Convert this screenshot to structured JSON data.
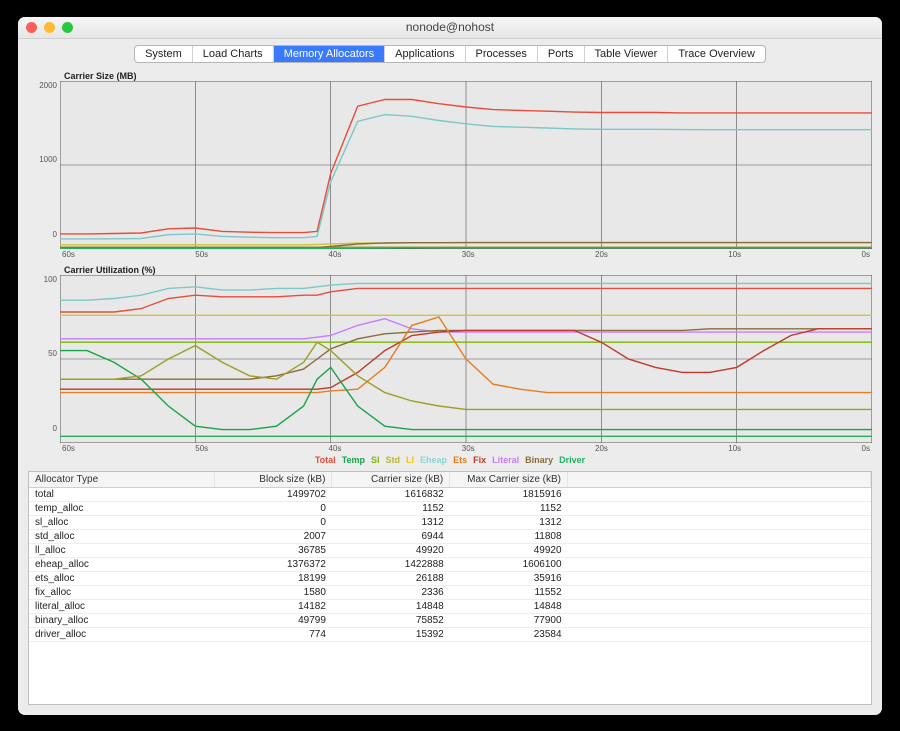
{
  "window_title": "nonode@nohost",
  "tabs": [
    "System",
    "Load Charts",
    "Memory Allocators",
    "Applications",
    "Processes",
    "Ports",
    "Table Viewer",
    "Trace Overview"
  ],
  "active_tab_index": 2,
  "legend": [
    {
      "name": "Total",
      "color": "#e74c3c"
    },
    {
      "name": "Temp",
      "color": "#1aa34a"
    },
    {
      "name": "Sl",
      "color": "#7ab800"
    },
    {
      "name": "Std",
      "color": "#b9b93a"
    },
    {
      "name": "Ll",
      "color": "#f1c40f"
    },
    {
      "name": "Eheap",
      "color": "#8fd3d3"
    },
    {
      "name": "Ets",
      "color": "#e67e22"
    },
    {
      "name": "Fix",
      "color": "#c0392b"
    },
    {
      "name": "Literal",
      "color": "#c77dff"
    },
    {
      "name": "Binary",
      "color": "#8a6d3b"
    },
    {
      "name": "Driver",
      "color": "#27ae60"
    }
  ],
  "chart_data": [
    {
      "type": "line",
      "title": "Carrier Size (MB)",
      "xlabel": "",
      "ylabel": "",
      "ylim": [
        0,
        2000
      ],
      "yticks": [
        0,
        1000,
        2000
      ],
      "xticks": [
        "60s",
        "50s",
        "40s",
        "30s",
        "20s",
        "10s",
        "0s"
      ],
      "x": [
        60,
        58,
        56,
        54,
        52,
        50,
        48,
        46,
        44,
        42,
        41,
        40,
        38,
        36,
        34,
        32,
        30,
        28,
        26,
        24,
        22,
        20,
        18,
        16,
        14,
        12,
        10,
        8,
        6,
        4,
        2,
        0
      ],
      "series": [
        {
          "name": "Total",
          "color": "#e74c3c",
          "values": [
            180,
            180,
            185,
            190,
            240,
            250,
            210,
            200,
            195,
            195,
            210,
            900,
            1700,
            1780,
            1780,
            1730,
            1690,
            1660,
            1650,
            1640,
            1630,
            1625,
            1625,
            1625,
            1620,
            1620,
            1620,
            1620,
            1620,
            1620,
            1620,
            1620
          ]
        },
        {
          "name": "Eheap",
          "color": "#7cc7c7",
          "values": [
            120,
            120,
            122,
            125,
            170,
            180,
            150,
            140,
            135,
            135,
            150,
            800,
            1520,
            1600,
            1580,
            1530,
            1490,
            1460,
            1450,
            1440,
            1430,
            1425,
            1425,
            1425,
            1422,
            1420,
            1420,
            1420,
            1420,
            1420,
            1420,
            1420
          ]
        },
        {
          "name": "Ll",
          "color": "#d0c438",
          "values": [
            50,
            50,
            50,
            50,
            50,
            50,
            50,
            50,
            50,
            50,
            55,
            60,
            70,
            72,
            74,
            75,
            76,
            76,
            76,
            76,
            76,
            76,
            76,
            76,
            76,
            76,
            76,
            76,
            76,
            76,
            76,
            76
          ]
        },
        {
          "name": "Std",
          "color": "#9e9e2a",
          "values": [
            22,
            22,
            22,
            22,
            22,
            22,
            22,
            22,
            22,
            22,
            22,
            22,
            22,
            22,
            22,
            22,
            22,
            22,
            22,
            22,
            22,
            22,
            22,
            22,
            22,
            22,
            22,
            22,
            22,
            22,
            22,
            22
          ]
        },
        {
          "name": "Binary",
          "color": "#8a6d3b",
          "values": [
            18,
            18,
            18,
            18,
            18,
            18,
            18,
            18,
            18,
            18,
            18,
            30,
            60,
            72,
            75,
            75,
            76,
            76,
            76,
            76,
            76,
            76,
            76,
            76,
            76,
            76,
            76,
            76,
            76,
            76,
            76,
            76
          ]
        },
        {
          "name": "Driver",
          "color": "#27ae60",
          "values": [
            8,
            8,
            8,
            8,
            8,
            8,
            8,
            8,
            8,
            8,
            8,
            8,
            10,
            12,
            14,
            15,
            15,
            15,
            15,
            15,
            15,
            15,
            15,
            15,
            15,
            15,
            15,
            15,
            15,
            15,
            15,
            15
          ]
        }
      ]
    },
    {
      "type": "line",
      "title": "Carrier Utilization (%)",
      "xlabel": "",
      "ylabel": "",
      "ylim": [
        0,
        100
      ],
      "yticks": [
        0,
        50,
        100
      ],
      "xticks": [
        "60s",
        "50s",
        "40s",
        "30s",
        "20s",
        "10s",
        "0s"
      ],
      "x": [
        60,
        58,
        56,
        54,
        52,
        50,
        48,
        46,
        44,
        42,
        41,
        40,
        38,
        36,
        34,
        32,
        30,
        28,
        26,
        24,
        22,
        20,
        18,
        16,
        14,
        12,
        10,
        8,
        6,
        4,
        2,
        0
      ],
      "series": [
        {
          "name": "Eheap",
          "color": "#7cc7c7",
          "values": [
            85,
            85,
            86,
            88,
            92,
            93,
            91,
            91,
            92,
            92,
            93,
            94,
            95,
            95,
            95,
            95,
            95,
            95,
            95,
            95,
            95,
            95,
            95,
            95,
            95,
            95,
            95,
            95,
            95,
            95,
            95,
            95
          ]
        },
        {
          "name": "Total",
          "color": "#e74c3c",
          "values": [
            78,
            78,
            78,
            80,
            86,
            88,
            87,
            87,
            87,
            88,
            88,
            90,
            92,
            92,
            92,
            92,
            92,
            92,
            92,
            92,
            92,
            92,
            92,
            92,
            92,
            92,
            92,
            92,
            92,
            92,
            92,
            92
          ]
        },
        {
          "name": "Ll",
          "color": "#d0c438",
          "values": [
            76,
            76,
            76,
            76,
            76,
            76,
            76,
            76,
            76,
            76,
            76,
            76,
            76,
            76,
            76,
            76,
            76,
            76,
            76,
            76,
            76,
            76,
            76,
            76,
            76,
            76,
            76,
            76,
            76,
            76,
            76,
            76
          ]
        },
        {
          "name": "Literal",
          "color": "#c77dff",
          "values": [
            62,
            62,
            62,
            62,
            62,
            62,
            62,
            62,
            62,
            62,
            63,
            64,
            70,
            74,
            68,
            66,
            66,
            66,
            66,
            66,
            66,
            66,
            66,
            66,
            66,
            66,
            66,
            66,
            66,
            66,
            66,
            66
          ]
        },
        {
          "name": "Sl",
          "color": "#7ab800",
          "values": [
            60,
            60,
            60,
            60,
            60,
            60,
            60,
            60,
            60,
            60,
            60,
            60,
            60,
            60,
            60,
            60,
            60,
            60,
            60,
            60,
            60,
            60,
            60,
            60,
            60,
            60,
            60,
            60,
            60,
            60,
            60,
            60
          ]
        },
        {
          "name": "Binary",
          "color": "#8a6d3b",
          "values": [
            38,
            38,
            38,
            38,
            38,
            38,
            38,
            38,
            40,
            44,
            50,
            56,
            62,
            65,
            66,
            67,
            67,
            67,
            67,
            67,
            67,
            67,
            67,
            67,
            67,
            68,
            68,
            68,
            68,
            68,
            68,
            68
          ]
        },
        {
          "name": "Fix",
          "color": "#c0392b",
          "values": [
            32,
            32,
            32,
            32,
            32,
            32,
            32,
            32,
            32,
            32,
            32,
            33,
            42,
            55,
            64,
            66,
            67,
            67,
            67,
            67,
            67,
            60,
            50,
            45,
            42,
            42,
            45,
            55,
            64,
            68,
            68,
            68
          ]
        },
        {
          "name": "Ets",
          "color": "#e67e22",
          "values": [
            30,
            30,
            30,
            30,
            30,
            30,
            30,
            30,
            30,
            30,
            30,
            31,
            32,
            45,
            70,
            75,
            50,
            35,
            32,
            30,
            30,
            30,
            30,
            30,
            30,
            30,
            30,
            30,
            30,
            30,
            30,
            30
          ]
        },
        {
          "name": "Temp",
          "color": "#1aa34a",
          "values": [
            55,
            55,
            48,
            38,
            22,
            10,
            8,
            8,
            10,
            22,
            38,
            45,
            22,
            10,
            8,
            8,
            8,
            8,
            8,
            8,
            8,
            8,
            8,
            8,
            8,
            8,
            8,
            8,
            8,
            8,
            8,
            8
          ]
        },
        {
          "name": "Std",
          "color": "#9e9e2a",
          "values": [
            38,
            38,
            38,
            40,
            50,
            58,
            48,
            40,
            38,
            48,
            60,
            55,
            40,
            30,
            25,
            22,
            20,
            20,
            20,
            20,
            20,
            20,
            20,
            20,
            20,
            20,
            20,
            20,
            20,
            20,
            20,
            20
          ]
        },
        {
          "name": "Driver",
          "color": "#27ae60",
          "values": [
            4,
            4,
            4,
            4,
            4,
            4,
            4,
            4,
            4,
            4,
            4,
            4,
            4,
            4,
            4,
            4,
            4,
            4,
            4,
            4,
            4,
            4,
            4,
            4,
            4,
            4,
            4,
            4,
            4,
            4,
            4,
            4
          ]
        }
      ]
    }
  ],
  "table": {
    "headers": [
      "Allocator Type",
      "Block size (kB)",
      "Carrier size (kB)",
      "Max Carrier size (kB)"
    ],
    "rows": [
      [
        "total",
        "1499702",
        "1616832",
        "1815916"
      ],
      [
        "temp_alloc",
        "0",
        "1152",
        "1152"
      ],
      [
        "sl_alloc",
        "0",
        "1312",
        "1312"
      ],
      [
        "std_alloc",
        "2007",
        "6944",
        "11808"
      ],
      [
        "ll_alloc",
        "36785",
        "49920",
        "49920"
      ],
      [
        "eheap_alloc",
        "1376372",
        "1422888",
        "1606100"
      ],
      [
        "ets_alloc",
        "18199",
        "26188",
        "35916"
      ],
      [
        "fix_alloc",
        "1580",
        "2336",
        "11552"
      ],
      [
        "literal_alloc",
        "14182",
        "14848",
        "14848"
      ],
      [
        "binary_alloc",
        "49799",
        "75852",
        "77900"
      ],
      [
        "driver_alloc",
        "774",
        "15392",
        "23584"
      ]
    ]
  }
}
